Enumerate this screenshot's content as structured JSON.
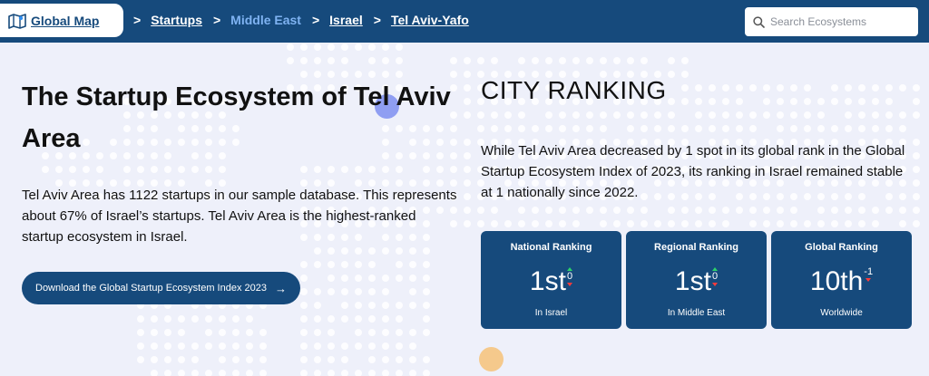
{
  "header": {
    "logo_label": "Global Map",
    "breadcrumbs": [
      {
        "label": "Startups",
        "type": "link"
      },
      {
        "label": "Middle East",
        "type": "current"
      },
      {
        "label": "Israel",
        "type": "link"
      },
      {
        "label": "Tel Aviv-Yafo",
        "type": "link"
      }
    ],
    "separator": ">",
    "search_placeholder": "Search Ecosystems"
  },
  "main": {
    "title": "The Startup Ecosystem of Tel Aviv Area",
    "description": "Tel Aviv Area has 1122 startups in our sample database. This represents about 67% of Israel’s startups. Tel Aviv Area is the highest-ranked startup ecosystem in Israel.",
    "download_button": "Download the Global Startup Ecosystem Index 2023",
    "download_arrow": "→"
  },
  "ranking": {
    "heading": "CITY RANKING",
    "description": "While Tel Aviv Area decreased by 1 spot in its global rank in the Global Startup Ecosystem Index of 2023, its ranking in Israel remained stable at 1 nationally since 2022.",
    "cards": [
      {
        "label": "National Ranking",
        "value": "1st",
        "delta": "0",
        "sub": "In Israel"
      },
      {
        "label": "Regional Ranking",
        "value": "1st",
        "delta": "0",
        "sub": "In Middle East"
      },
      {
        "label": "Global Ranking",
        "value": "10th",
        "delta": "-1",
        "sub": "Worldwide"
      }
    ]
  },
  "colors": {
    "brand": "#164a7c",
    "background": "#eef0fa",
    "breadcrumb_current": "#7fb3f2",
    "delta_up": "#2bd46a",
    "delta_down": "#ff3b3b"
  }
}
